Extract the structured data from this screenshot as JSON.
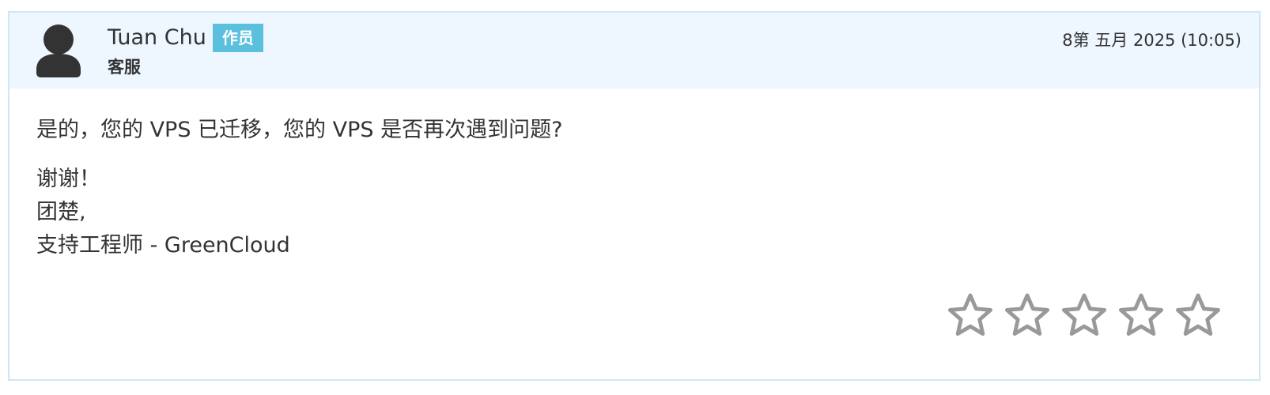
{
  "reply": {
    "author_name": "Tuan Chu",
    "badge": "作员",
    "role": "客服",
    "date": "8第 五月 2025 (10:05)",
    "message": "是的，您的 VPS 已迁移，您的 VPS 是否再次遇到问题?",
    "signature": [
      "谢谢！",
      "团楚,",
      "支持工程师 - GreenCloud"
    ]
  },
  "rating": {
    "max": 5,
    "value": 0,
    "star_color": "#999999"
  },
  "colors": {
    "header_bg": "#eef7ff",
    "border": "#cfe6f7",
    "badge_bg": "#5bc0de",
    "avatar": "#333333"
  },
  "icons": {
    "avatar": "user-icon",
    "star": "star-outline-icon"
  }
}
